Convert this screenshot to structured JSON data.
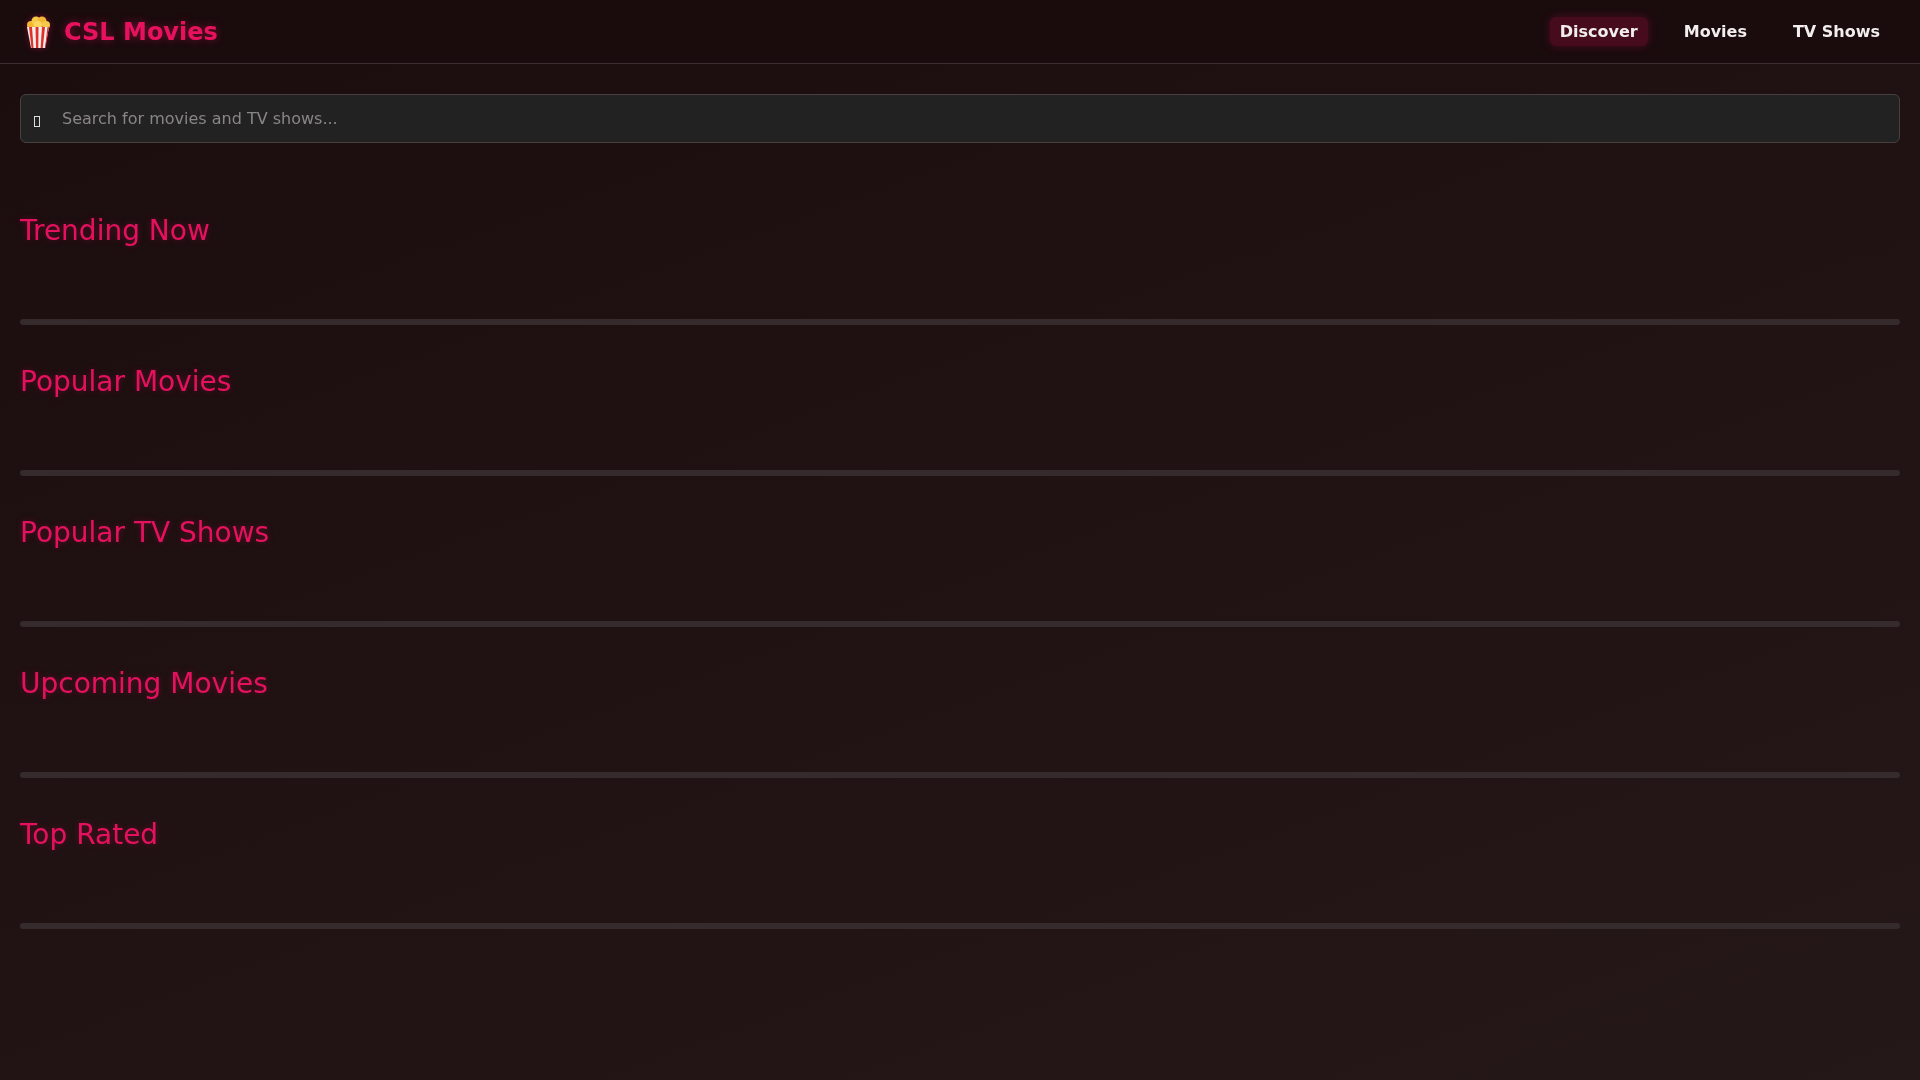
{
  "header": {
    "logo": {
      "text": "CSL Movies"
    },
    "nav": [
      {
        "label": "Discover",
        "selected": true
      },
      {
        "label": "Movies",
        "selected": false
      },
      {
        "label": "TV Shows",
        "selected": false
      }
    ]
  },
  "search": {
    "placeholder": "Search for movies and TV shows..."
  },
  "sections": [
    {
      "title": "Trending Now"
    },
    {
      "title": "Popular Movies"
    },
    {
      "title": "Popular TV Shows"
    },
    {
      "title": "Upcoming Movies"
    },
    {
      "title": "Top Rated"
    }
  ]
}
